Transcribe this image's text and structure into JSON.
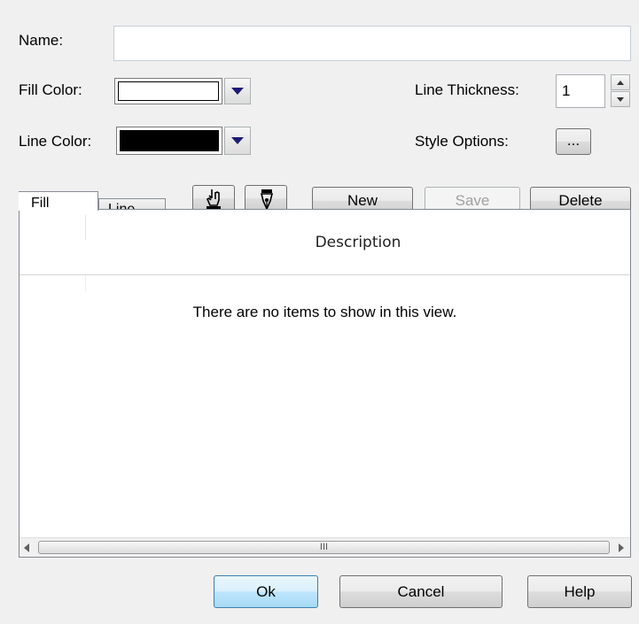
{
  "form": {
    "name_label": "Name:",
    "name_value": "",
    "fill_color_label": "Fill Color:",
    "line_color_label": "Line Color:",
    "line_thickness_label": "Line Thickness:",
    "line_thickness_value": "1",
    "style_options_label": "Style Options:",
    "style_options_button": "...",
    "fill_color": "#ffffff",
    "line_color": "#000000"
  },
  "tabs": [
    {
      "label": "Fill",
      "active": true
    },
    {
      "label": "Line",
      "active": false
    }
  ],
  "toolbar": {
    "new_label": "New",
    "save_label": "Save",
    "delete_label": "Delete"
  },
  "list": {
    "columns": [
      "",
      "Description"
    ],
    "empty_message": "There are no items to show in this view.",
    "scroll_grip": "III"
  },
  "footer": {
    "ok_label": "Ok",
    "cancel_label": "Cancel",
    "help_label": "Help"
  }
}
